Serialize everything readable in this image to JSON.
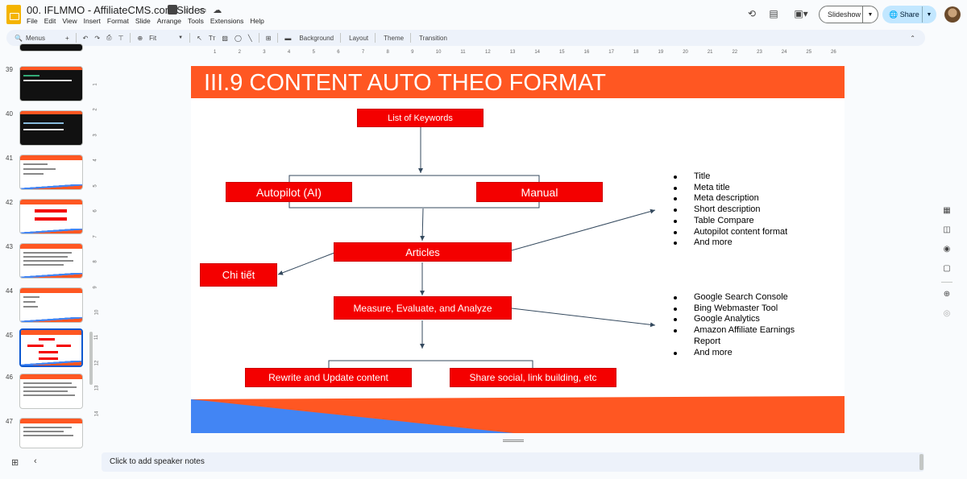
{
  "app": {
    "doc_title": "00. IFLMMO - AffiliateCMS.com Slides",
    "menu": [
      "File",
      "Edit",
      "View",
      "Insert",
      "Format",
      "Slide",
      "Arrange",
      "Tools",
      "Extensions",
      "Help"
    ],
    "slideshow_label": "Slideshow",
    "share_label": "Share"
  },
  "toolbar": {
    "search_label": "Menus",
    "zoom_label": "Fit",
    "background_label": "Background",
    "layout_label": "Layout",
    "theme_label": "Theme",
    "transition_label": "Transition"
  },
  "thumbnails": [
    {
      "num": "39",
      "selected": false
    },
    {
      "num": "40",
      "selected": false
    },
    {
      "num": "41",
      "selected": false
    },
    {
      "num": "42",
      "selected": false
    },
    {
      "num": "43",
      "selected": false
    },
    {
      "num": "44",
      "selected": false
    },
    {
      "num": "45",
      "selected": true
    },
    {
      "num": "46",
      "selected": false
    },
    {
      "num": "47",
      "selected": false
    }
  ],
  "ruler": {
    "h_ticks": [
      "1",
      "2",
      "3",
      "4",
      "5",
      "6",
      "7",
      "8",
      "9",
      "10",
      "11",
      "12",
      "13",
      "14",
      "15",
      "16",
      "17",
      "18",
      "19",
      "20",
      "21",
      "22",
      "23",
      "24",
      "25",
      "26"
    ],
    "v_ticks": [
      "1",
      "2",
      "3",
      "4",
      "5",
      "6",
      "7",
      "8",
      "9",
      "10",
      "11",
      "12",
      "13",
      "14"
    ]
  },
  "slide": {
    "title": "III.9 CONTENT AUTO THEO FORMAT",
    "nodes": {
      "keywords": "List of Keywords",
      "autopilot": "Autopilot (AI)",
      "manual": "Manual",
      "articles": "Articles",
      "chitiet": "Chi tiết",
      "measure": "Measure, Evaluate, and Analyze",
      "rewrite": "Rewrite and Update content",
      "share": "Share social, link building, etc"
    },
    "bullets_top": [
      "Title",
      "Meta title",
      "Meta description",
      "Short description",
      "Table Compare",
      "Autopilot content format",
      "And more"
    ],
    "bullets_bottom": [
      "Google Search Console",
      "Bing Webmaster Tool",
      "Google Analytics",
      "Amazon Affiliate Earnings",
      "Report",
      "And more"
    ],
    "colors": {
      "header": "#ff5722",
      "node": "#f40000",
      "blue": "#4285f4"
    }
  },
  "notes": {
    "placeholder": "Click to add speaker notes"
  }
}
